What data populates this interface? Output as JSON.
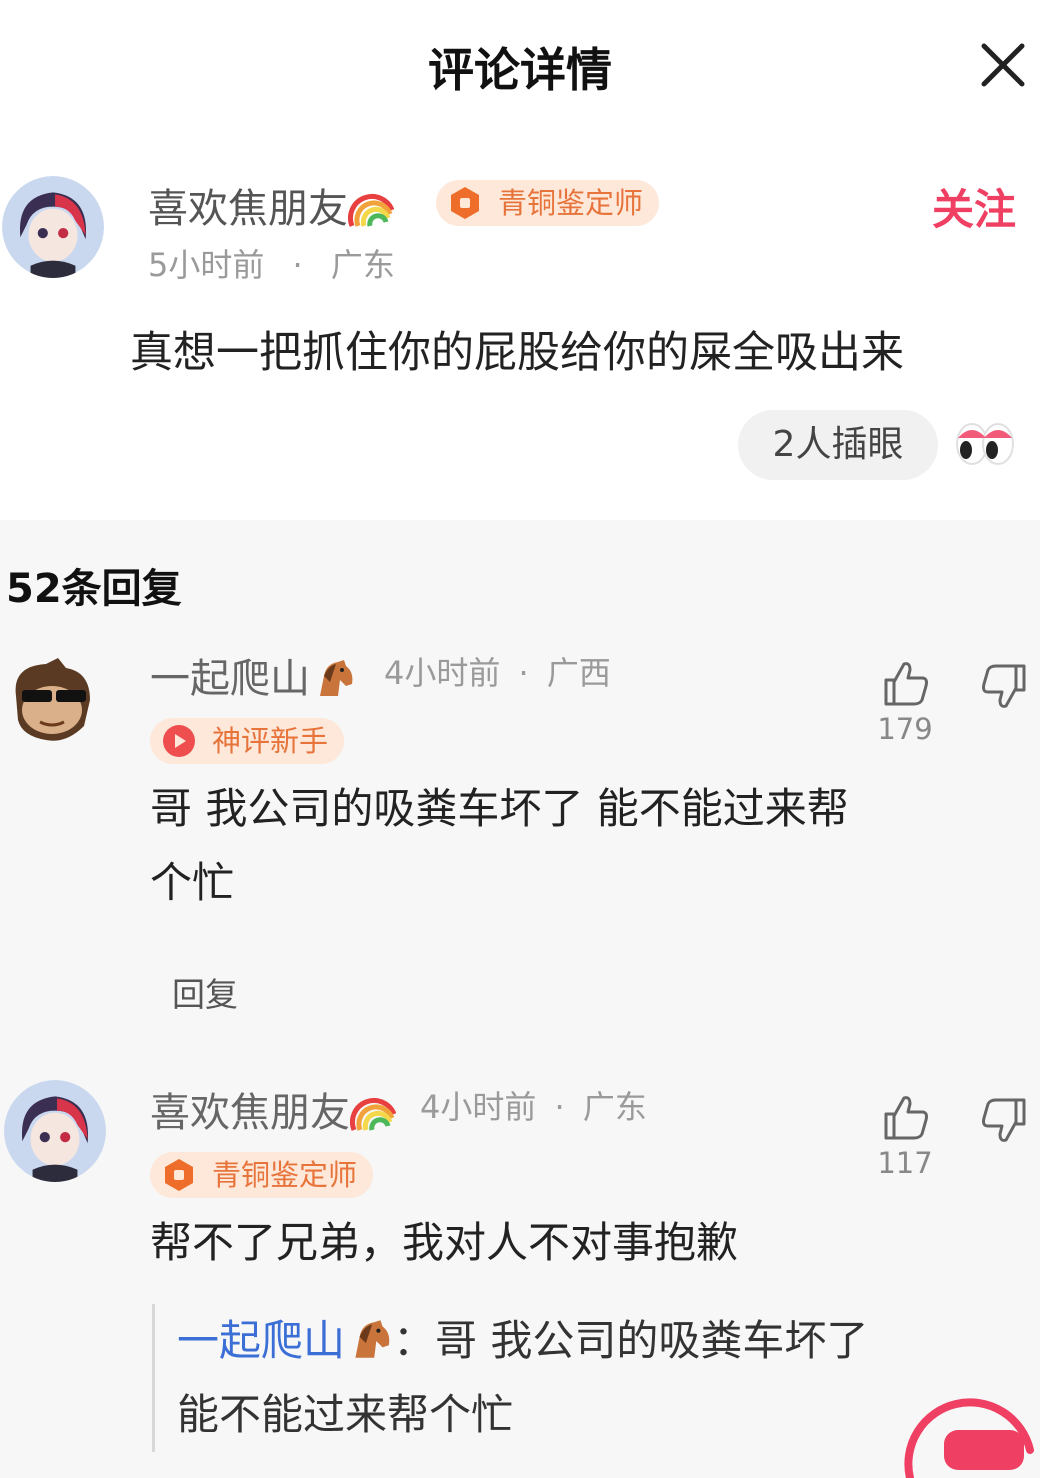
{
  "header": {
    "title": "评论详情"
  },
  "main_comment": {
    "username": "喜欢焦朋友",
    "badge": "青铜鉴定师",
    "time": "5小时前",
    "sep": "·",
    "location": "广东",
    "follow_label": "关注",
    "text": "真想一把抓住你的屁股给你的屎全吸出来",
    "reaction_label": "2人插眼"
  },
  "replies_count_label": "52条回复",
  "replies": [
    {
      "username": "一起爬山",
      "time": "4小时前",
      "sep": "·",
      "location": "广西",
      "badge": "神评新手",
      "text_line1": "哥  我公司的吸粪车坏了  能不能过来帮",
      "text_line2": "个忙",
      "likes": "179",
      "reply_label": "回复"
    },
    {
      "username": "喜欢焦朋友",
      "time": "4小时前",
      "sep": "·",
      "location": "广东",
      "badge": "青铜鉴定师",
      "text": "帮不了兄弟，我对人不对事抱歉",
      "likes": "117",
      "quote_name": "一起爬山",
      "quote_colon": "：",
      "quote_text_line1": "哥  我公司的吸粪车坏了",
      "quote_text_line2": "能不能过来帮个忙"
    }
  ],
  "icons": {
    "close": "close-icon",
    "like": "thumbs-up-icon",
    "dislike": "thumbs-down-icon",
    "rainbow": "rainbow-emoji-icon",
    "horse": "horse-emoji-icon",
    "eyes": "eyes-emoji-icon"
  },
  "colors": {
    "follow": "#ef3f63",
    "badge_bg": "#fde8da",
    "badge_text": "#e7743b",
    "quote_name": "#3b6fd6"
  }
}
